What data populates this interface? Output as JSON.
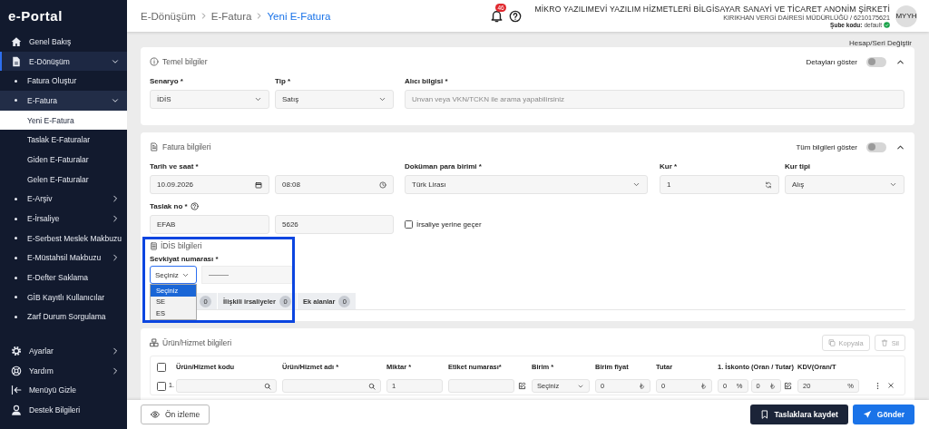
{
  "logo": "e-Portal",
  "sidebar": {
    "items": [
      {
        "label": "Genel Bakış",
        "selected": false
      },
      {
        "label": "E-Dönüşüm",
        "selected": false,
        "expanded": true,
        "children": [
          {
            "label": "Fatura Oluştur",
            "selected": false
          },
          {
            "label": "E-Fatura",
            "selected": false,
            "expanded": true,
            "children": [
              {
                "label": "Yeni E-Fatura",
                "selected": true
              },
              {
                "label": "Taslak E-Faturalar",
                "selected": false
              },
              {
                "label": "Giden E-Faturalar",
                "selected": false
              },
              {
                "label": "Gelen E-Faturalar",
                "selected": false
              }
            ]
          },
          {
            "label": "E-Arşiv",
            "selected": false,
            "expanded": false
          },
          {
            "label": "E-İrsaliye",
            "selected": false,
            "expanded": false
          },
          {
            "label": "E-Serbest Meslek Makbuzu",
            "selected": false,
            "expanded": false
          },
          {
            "label": "E-Müstahsil Makbuzu",
            "selected": false,
            "expanded": false
          },
          {
            "label": "E-Defter Saklama",
            "selected": false
          },
          {
            "label": "GİB Kayıtlı Kullanıcılar",
            "selected": false
          },
          {
            "label": "Zarf Durum Sorgulama",
            "selected": false
          }
        ]
      }
    ],
    "footer_items": [
      {
        "label": "Ayarlar",
        "selected": false,
        "expanded": false
      },
      {
        "label": "Yardım",
        "selected": false,
        "expanded": false
      },
      {
        "label": "Menüyü Gizle",
        "selected": false
      },
      {
        "label": "Destek Bilgileri",
        "selected": false
      }
    ]
  },
  "header": {
    "breadcrumb": [
      {
        "label": "E-Dönüşüm",
        "current": false
      },
      {
        "label": "E-Fatura",
        "current": false
      },
      {
        "label": "Yeni E-Fatura",
        "current": true
      }
    ],
    "notification_count": "46",
    "company": {
      "name": "MİKRO YAZILIMEVİ YAZILIM HİZMETLERİ BİLGİSAYAR SANAYİ VE TİCARET ANONİM ŞİRKETİ",
      "tax_office": "KIRIKHAN VERGİ DAİRESİ MÜDÜRLÜĞÜ / 6210175621",
      "branch_label": "Şube kodu:",
      "branch_value": "default",
      "branch_active": true
    },
    "avatar": "MYYH"
  },
  "account_link": "Hesap/Seri Değiştir",
  "basic_info": {
    "title": "Temel bilgiler",
    "toggle": {
      "label": "Detayları göster",
      "on": false
    },
    "expanded": true,
    "rows": [
      [
        {
          "label": "Senaryo *",
          "inputs": [
            {
              "kind": "select",
              "value": "İDİS"
            }
          ]
        },
        {
          "label": "Tip *",
          "inputs": [
            {
              "kind": "select",
              "value": "Satış"
            }
          ]
        },
        {
          "label": "Alıcı bilgisi *",
          "inputs": [
            {
              "kind": "text",
              "placeholder": "Unvan veya VKN/TCKN ile arama yapabilirsiniz"
            }
          ]
        }
      ]
    ]
  },
  "invoice_info": {
    "title": "Fatura bilgileri",
    "toggle": {
      "label": "Tüm bilgileri göster",
      "on": false
    },
    "expanded": true,
    "rows": [
      [
        {
          "label": "Tarih ve saat *",
          "inputs": [
            {
              "kind": "date",
              "value": "10.09.2026"
            },
            {
              "kind": "time",
              "value": "08:08"
            }
          ]
        },
        {
          "label": "Doküman para birimi *",
          "inputs": [
            {
              "kind": "select",
              "value": "Türk Lirası"
            }
          ]
        },
        {
          "label": "Kur *",
          "inputs": [
            {
              "kind": "rate",
              "value": "1"
            }
          ]
        },
        {
          "label": "Kur tipi",
          "inputs": [
            {
              "kind": "select",
              "value": "Alış"
            }
          ]
        }
      ],
      [
        {
          "label": "Taslak no *",
          "help": true,
          "inputs": [
            {
              "kind": "text",
              "value": "EFAB"
            },
            {
              "kind": "text",
              "value": "5626"
            }
          ]
        },
        {
          "kind": "checkbox",
          "label": "İrsaliye yerine geçer",
          "checked": false
        }
      ]
    ],
    "idis": {
      "title": "İDİS bilgileri",
      "highlighted": true,
      "label": "Sevkiyat numarası *",
      "select": {
        "value": "Seçiniz",
        "open": true,
        "options": [
          {
            "label": "Seçiniz",
            "selected": true
          },
          {
            "label": "SE",
            "selected": false
          },
          {
            "label": "ES",
            "selected": false
          }
        ]
      },
      "tabs": [
        {
          "count": "0"
        },
        {
          "label": "İlişkili irsaliyeler",
          "count": "0"
        },
        {
          "label": "Ek alanlar",
          "count": "0"
        }
      ]
    }
  },
  "items": {
    "title": "Ürün/Hizmet bilgileri",
    "buttons": [
      {
        "label": "Kopyala",
        "disabled": true
      },
      {
        "label": "Sil",
        "disabled": true
      }
    ],
    "table": {
      "all_checked": false,
      "columns": [
        "Ürün/Hizmet kodu",
        "Ürün/Hizmet adı *",
        "Miktar *",
        "Etiket numarası*",
        "Birim *",
        "Birim fiyat",
        "Tutar",
        "1. İskonto (Oran / Tutar)",
        "KDV(Oran/T"
      ],
      "rows": [
        {
          "number": "1.",
          "checked": false,
          "cells": [
            {
              "kind": "search"
            },
            {
              "kind": "search"
            },
            {
              "kind": "text",
              "value": "1"
            },
            {
              "kind": "edit"
            },
            {
              "kind": "select",
              "value": "Seçiniz"
            },
            {
              "kind": "money",
              "value": "0"
            },
            {
              "kind": "money",
              "value": "0"
            },
            {
              "kind": "discount",
              "value": "0",
              "unit": "%",
              "amount": "0"
            },
            {
              "kind": "percent",
              "value": "20",
              "unit": "%"
            }
          ]
        }
      ]
    }
  },
  "footer_buttons": [
    {
      "label": "Ön izleme",
      "kind": "secondary"
    },
    {
      "label": "Taslaklara kaydet",
      "kind": "dark"
    },
    {
      "label": "Gönder",
      "kind": "primary"
    }
  ]
}
